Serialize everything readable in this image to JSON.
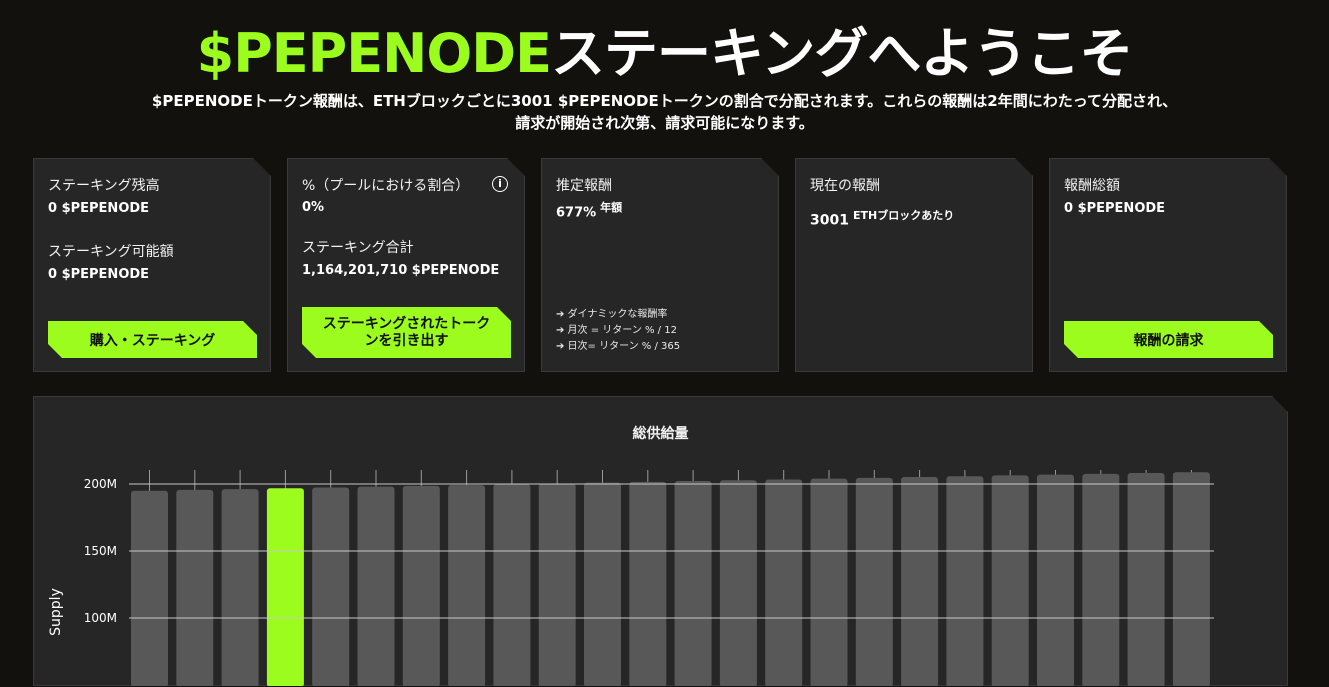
{
  "hero": {
    "brand": "$PEPENODE",
    "title_rest": "ステーキングへようこそ",
    "subtitle": "$PEPENODEトークン報酬は、ETHブロックごとに3001 $PEPENODEトークンの割合で分配されます。これらの報酬は2年間にわたって分配され、請求が開始され次第、請求可能になります。"
  },
  "cards": {
    "staking": {
      "balance_label": "ステーキング残高",
      "balance_value": "0 $PEPENODE",
      "available_label": "ステーキング可能額",
      "available_value": "0 $PEPENODE",
      "button": "購入・ステーキング"
    },
    "pool": {
      "share_label": "%（プールにおける割合）",
      "share_value": "0%",
      "total_label": "ステーキング合計",
      "total_value": "1,164,201,710 $PEPENODE",
      "button": "ステーキングされたトークンを引き出す",
      "info_icon": "info-icon"
    },
    "estimated": {
      "label": "推定報酬",
      "value": "677%",
      "unit": "年額",
      "notes": [
        "➔ ダイナミックな報酬率",
        "➔ 月次 = リターン % / 12",
        "➔ 日次= リターン % / 365"
      ]
    },
    "current": {
      "label": "現在の報酬",
      "value": "3001",
      "unit": "ETHブロックあたり"
    },
    "total": {
      "label": "報酬総額",
      "value": "0 $PEPENODE",
      "button": "報酬の請求"
    }
  },
  "colors": {
    "accent": "#9bfc1d",
    "background": "#12110d",
    "card": "#262626",
    "bar": "#585858"
  },
  "chart_data": {
    "type": "bar",
    "title": "総供給量",
    "ylabel": "Supply",
    "ytick_labels": [
      "100M",
      "150M",
      "200M"
    ],
    "yticks": [
      100,
      150,
      200
    ],
    "ylim_visible": [
      75,
      210
    ],
    "highlight_index": 3,
    "values": [
      195,
      195.6,
      196.2,
      196.8,
      197.4,
      198,
      198.6,
      199.2,
      199.8,
      200.4,
      201,
      201.6,
      202.2,
      202.8,
      203.4,
      204,
      204.6,
      205.2,
      205.8,
      206.4,
      207,
      207.6,
      208.2,
      208.8
    ]
  }
}
